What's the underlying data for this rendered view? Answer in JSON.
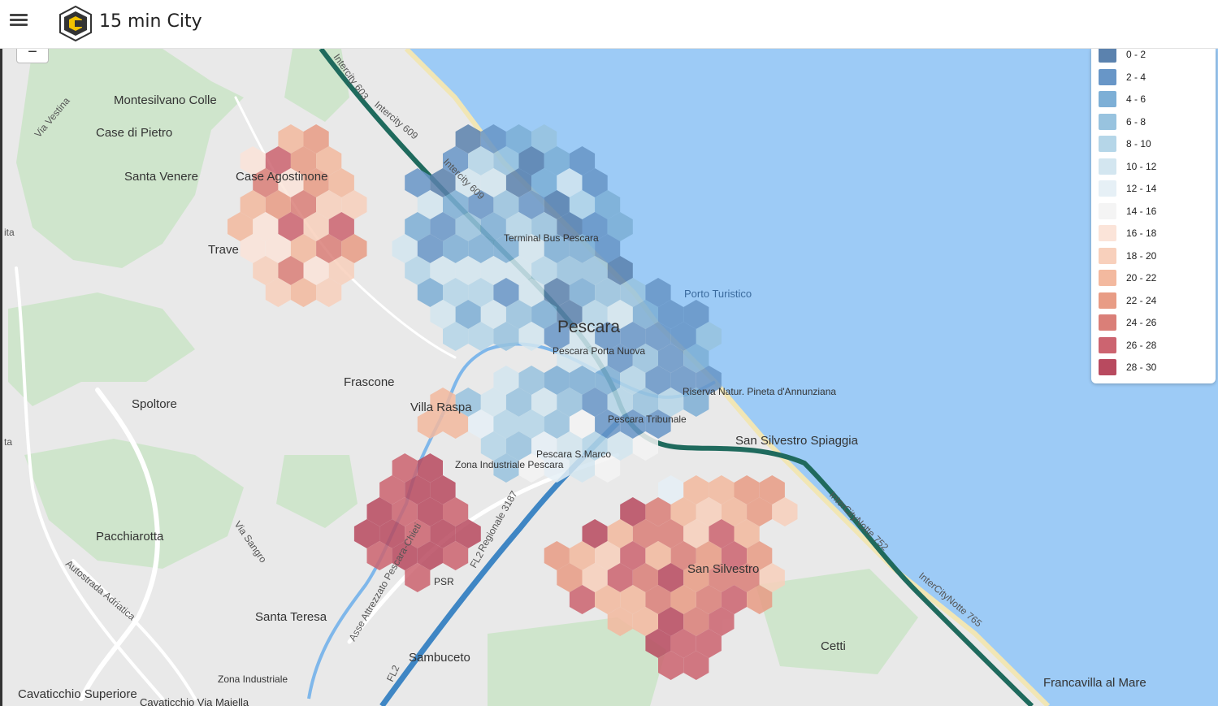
{
  "app": {
    "title": "15 min City"
  },
  "zoom": {
    "out_label": "−"
  },
  "legend": [
    {
      "label": "0 - 2",
      "color": "#5b82ae"
    },
    {
      "label": "2 - 4",
      "color": "#6896c7"
    },
    {
      "label": "4 - 6",
      "color": "#7dafd6"
    },
    {
      "label": "6 - 8",
      "color": "#98c3df"
    },
    {
      "label": "8 - 10",
      "color": "#b5d6e8"
    },
    {
      "label": "10 - 12",
      "color": "#d3e6f0"
    },
    {
      "label": "12 - 14",
      "color": "#e6f0f6"
    },
    {
      "label": "14 - 16",
      "color": "#f4f4f4"
    },
    {
      "label": "16 - 18",
      "color": "#fbe4d9"
    },
    {
      "label": "18 - 20",
      "color": "#f8d0bc"
    },
    {
      "label": "20 - 22",
      "color": "#f3b99f"
    },
    {
      "label": "22 - 24",
      "color": "#e89c85"
    },
    {
      "label": "24 - 26",
      "color": "#da7f78"
    },
    {
      "label": "26 - 28",
      "color": "#cc6470"
    },
    {
      "label": "28 - 30",
      "color": "#b84a5f"
    }
  ],
  "map": {
    "places": [
      "Montesilvano Colle",
      "Case di Pietro",
      "Santa Venere",
      "Case Agostinone",
      "Trave",
      "Frascone",
      "Spoltore",
      "Villa Raspa",
      "Pacchiarotta",
      "Santa Teresa",
      "Sambuceto",
      "Cavaticchio Superiore",
      "Cavaticchio Via Majella",
      "Zona Industriale",
      "Cetti",
      "Francavilla al Mare",
      "San Silvestro",
      "San Silvestro Spiaggia",
      "Pescara",
      "Pescara Porta Nuova",
      "Pescara Tribunale",
      "Pescara S.Marco",
      "Zona Industriale Pescara",
      "Terminal Bus Pescara",
      "Porto Turistico",
      "Riserva Natur. Pineta d'Annunziana",
      "PSR"
    ],
    "roads": [
      "Via Vestina",
      "Intercity 603",
      "Intercity 609",
      "Intercity 609",
      "InterCityNotte 752",
      "InterCityNotte 765",
      "Regionale 3187",
      "FL2",
      "FL2",
      "Autostrada Adriatica",
      "Asse Attrezzato Pescara-Chieti",
      "Via Sangro",
      "ita",
      "ta"
    ]
  }
}
